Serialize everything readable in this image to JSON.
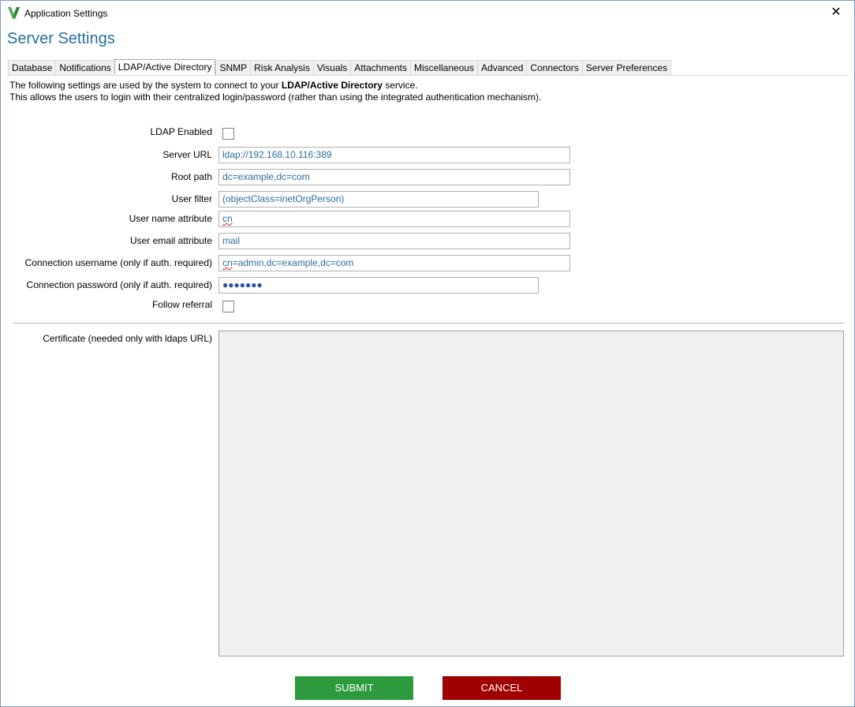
{
  "window": {
    "title": "Application Settings",
    "close_glyph": "✕"
  },
  "page": {
    "title": "Server Settings"
  },
  "tabs": [
    {
      "label": "Database",
      "active": false
    },
    {
      "label": "Notifications",
      "active": false
    },
    {
      "label": "LDAP/Active Directory",
      "active": true
    },
    {
      "label": "SNMP",
      "active": false
    },
    {
      "label": "Risk Analysis",
      "active": false
    },
    {
      "label": "Visuals",
      "active": false
    },
    {
      "label": "Attachments",
      "active": false
    },
    {
      "label": "Miscellaneous",
      "active": false
    },
    {
      "label": "Advanced",
      "active": false
    },
    {
      "label": "Connectors",
      "active": false
    },
    {
      "label": "Server Preferences",
      "active": false
    }
  ],
  "description": {
    "line1_prefix": "The following settings are used by the system to connect to your ",
    "line1_bold": "LDAP/Active Directory",
    "line1_suffix": " service.",
    "line2": "This allows the users to login with their centralized login/password (rather than using the integrated authentication mechanism)."
  },
  "form": {
    "ldap_enabled": {
      "label": "LDAP Enabled",
      "checked": false
    },
    "server_url": {
      "label": "Server URL",
      "value": "ldap://192.168.10.116:389"
    },
    "root_path": {
      "label": "Root path",
      "value": "dc=example,dc=com"
    },
    "user_filter": {
      "label": "User filter",
      "value": "(objectClass=inetOrgPerson)"
    },
    "user_name_attribute": {
      "label": "User name attribute",
      "value": "cn"
    },
    "user_email_attribute": {
      "label": "User email attribute",
      "value": "mail"
    },
    "connection_username": {
      "label": "Connection username (only if auth. required)",
      "value_prefix": "cn",
      "value_rest": "=admin,dc=example,dc=com"
    },
    "connection_password": {
      "label": "Connection password (only if auth. required)",
      "value": "●●●●●●●"
    },
    "follow_referral": {
      "label": "Follow referral",
      "checked": false
    },
    "certificate": {
      "label": "Certificate (needed only with ldaps URL)",
      "value": ""
    }
  },
  "buttons": {
    "submit": "SUBMIT",
    "cancel": "CANCEL"
  },
  "colors": {
    "title_blue": "#2a6f9e",
    "submit_green": "#2e9a3e",
    "cancel_red": "#a00000"
  },
  "icons": {
    "app": "app-logo-icon",
    "close": "close-icon"
  }
}
